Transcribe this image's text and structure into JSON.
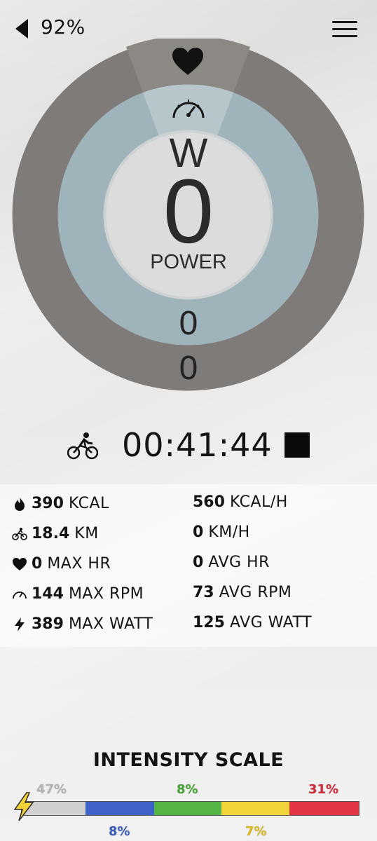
{
  "status": {
    "battery": "92%"
  },
  "gauge": {
    "unit": "W",
    "value": "0",
    "label": "POWER",
    "inner_ring_value": "0",
    "outer_ring_value": "0",
    "colors": {
      "outer": "#7f7b78",
      "inner": "#9fb3ba",
      "center": "#dcdcdc"
    }
  },
  "session": {
    "elapsed": "00:41:44"
  },
  "stats": {
    "left": [
      {
        "icon": "flame-icon",
        "value": "390",
        "unit": "KCAL"
      },
      {
        "icon": "bike-icon",
        "value": "18.4",
        "unit": "KM"
      },
      {
        "icon": "heart-icon",
        "value": "0",
        "unit": "MAX HR"
      },
      {
        "icon": "speedometer-icon",
        "value": "144",
        "unit": "MAX RPM"
      },
      {
        "icon": "bolt-icon",
        "value": "389",
        "unit": "MAX WATT"
      }
    ],
    "right": [
      {
        "value": "560",
        "unit": "KCAL/H"
      },
      {
        "value": "0",
        "unit": "KM/H"
      },
      {
        "value": "0",
        "unit": "AVG HR"
      },
      {
        "value": "73",
        "unit": "AVG RPM"
      },
      {
        "value": "125",
        "unit": "AVG WATT"
      }
    ]
  },
  "intensity": {
    "title": "INTENSITY SCALE",
    "segments": [
      {
        "pct": "47%",
        "color": "#d0d0d0",
        "label_color": "#b5b5b5"
      },
      {
        "pct": "8%",
        "color": "#3f63c8",
        "label_color": "#3f5fbf"
      },
      {
        "pct": "8%",
        "color": "#55b544",
        "label_color": "#4aa83a"
      },
      {
        "pct": "7%",
        "color": "#f1d43a",
        "label_color": "#d9bb20"
      },
      {
        "pct": "31%",
        "color": "#e13542",
        "label_color": "#cf2e3a"
      }
    ]
  }
}
